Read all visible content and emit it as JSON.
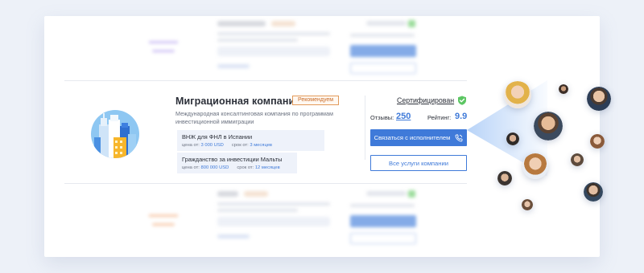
{
  "company": {
    "title": "Миграционная компания",
    "badge": "Рекомендуем",
    "description": "Международная консалтинговая компания по программам инвестиционной иммиграции",
    "services": [
      {
        "title": "ВНЖ для ФНЛ в Испании",
        "price_label": "цена от:",
        "price": "3 000 USD",
        "term_label": "срок от:",
        "term": "3 месяцев"
      },
      {
        "title": "Гражданство за инвестиции Мальты",
        "price_label": "цена от:",
        "price": "800 000 USD",
        "term_label": "срок от:",
        "term": "12 месяцев"
      }
    ]
  },
  "sidebar": {
    "certified": "Сертифицирован",
    "reviews_label": "Отзывы:",
    "reviews_value": "250",
    "rating_label": "Рейтинг:",
    "rating_value": "9.9",
    "contact_button": "Связаться с исполнителем",
    "services_button": "Все услуги компании"
  },
  "icons": {
    "certified": "shield-check-icon",
    "phone": "phone-icon",
    "logo": "city-buildings-icon"
  },
  "colors": {
    "accent": "#3f7ad9",
    "badge_border": "#e29a5a",
    "certified_green": "#5cc663",
    "ghost_purple": "#b9a6ef",
    "ghost_orange": "#f3b083"
  }
}
